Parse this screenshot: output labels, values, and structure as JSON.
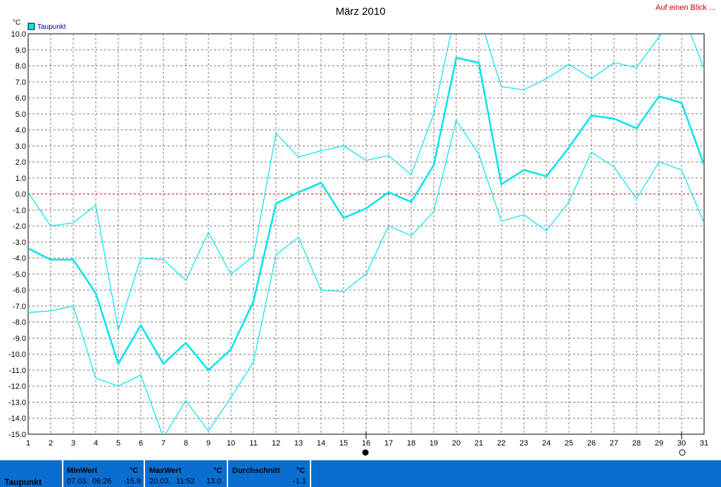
{
  "header": {
    "title": "März 2010",
    "overview_link": "Auf einen Blick ..."
  },
  "legend": {
    "label": "Taupunkt",
    "color": "#00e5ee"
  },
  "chart_data": {
    "type": "line",
    "title": "März 2010",
    "ylabel": "°C",
    "xlabel": "",
    "x": [
      1,
      2,
      3,
      4,
      5,
      6,
      7,
      8,
      9,
      10,
      11,
      12,
      13,
      14,
      15,
      16,
      17,
      18,
      19,
      20,
      21,
      22,
      23,
      24,
      25,
      26,
      27,
      28,
      29,
      30,
      31
    ],
    "ylim": [
      -15.0,
      10.0
    ],
    "yticks": [
      10.0,
      9.0,
      8.0,
      7.0,
      6.0,
      5.0,
      4.0,
      3.0,
      2.0,
      1.0,
      0.0,
      -1.0,
      -2.0,
      -3.0,
      -4.0,
      -5.0,
      -6.0,
      -7.0,
      -8.0,
      -9.0,
      -10.0,
      -11.0,
      -12.0,
      -13.0,
      -14.0,
      -15.0
    ],
    "ytick_labels": [
      "10.0",
      "9.0",
      "8.0",
      "7.0",
      "6.0",
      "5.0",
      "4.0",
      "3.0",
      "2.0",
      "1.0",
      "0.0",
      "-1.0",
      "-2.0",
      "-3.0",
      "-4.0",
      "-5.0",
      "-6.0",
      "-7.0",
      "-8.0",
      "-9.0",
      "-10.0",
      "-11.0",
      "-12.0",
      "-13.0",
      "-14.0",
      "-15.0"
    ],
    "grid": true,
    "zero_line_color": "#cc0000",
    "series": [
      {
        "name": "Taupunkt",
        "role": "mean",
        "color": "#00e5ee",
        "values": [
          -3.4,
          -4.1,
          -4.1,
          -6.2,
          -10.6,
          -8.2,
          -10.6,
          -9.3,
          -11.0,
          -9.7,
          -6.7,
          -0.6,
          0.1,
          0.7,
          -1.5,
          -0.9,
          0.1,
          -0.5,
          1.8,
          8.5,
          8.2,
          0.6,
          1.5,
          1.1,
          2.9,
          4.9,
          4.7,
          4.1,
          6.1,
          5.7,
          1.8
        ]
      },
      {
        "role": "max",
        "color": "#00e5ee",
        "values": [
          0.1,
          -2.0,
          -1.8,
          -0.7,
          -8.5,
          -4.0,
          -4.1,
          -5.4,
          -2.4,
          -5.0,
          -3.9,
          3.8,
          2.3,
          2.7,
          3.0,
          2.1,
          2.4,
          1.2,
          5.0,
          11.6,
          11.2,
          6.7,
          6.5,
          7.2,
          8.1,
          7.2,
          8.2,
          7.9,
          9.8,
          11.5,
          7.8
        ]
      },
      {
        "role": "min",
        "color": "#00e5ee",
        "values": [
          -7.4,
          -7.3,
          -7.0,
          -11.5,
          -12.0,
          -11.3,
          -15.2,
          -12.9,
          -14.8,
          -12.7,
          -10.5,
          -3.8,
          -2.7,
          -6.0,
          -6.1,
          -5.0,
          -2.0,
          -2.6,
          -1.1,
          4.6,
          2.5,
          -1.7,
          -1.3,
          -2.3,
          -0.5,
          2.6,
          1.7,
          -0.3,
          2.0,
          1.5,
          -1.8
        ]
      }
    ],
    "markers": {
      "min_day": 16,
      "max_day": 30
    }
  },
  "stats": {
    "row_label": "Taupunkt",
    "min": {
      "title": "MinWert",
      "unit": "°C",
      "date": "07.03.",
      "time": "06:26",
      "value": "-15.9"
    },
    "max": {
      "title": "MaxWert",
      "unit": "°C",
      "date": "20.03.",
      "time": "11:52",
      "value": "13.0"
    },
    "avg": {
      "title": "Durchschnitt",
      "unit": "°C",
      "value": "-1.1"
    }
  }
}
